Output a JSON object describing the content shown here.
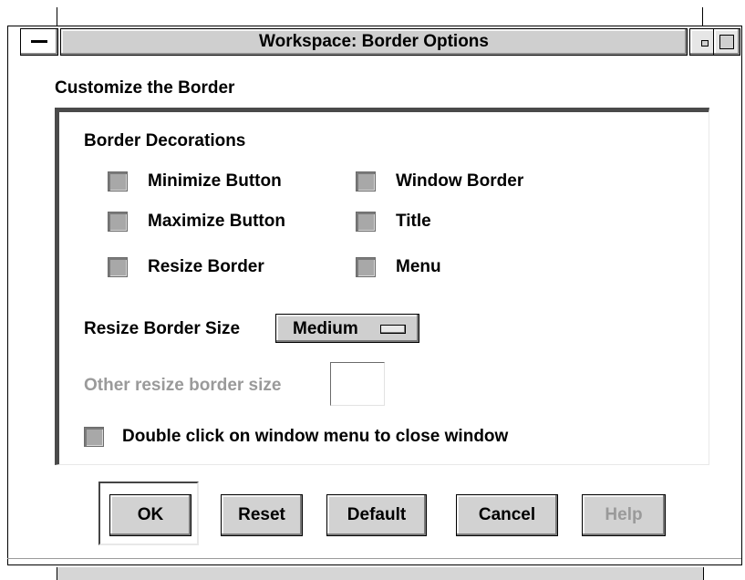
{
  "window": {
    "title": "Workspace: Border Options",
    "menu_icon": "window-menu-icon",
    "minimize_icon": "minimize-icon",
    "maximize_icon": "maximize-icon"
  },
  "heading": "Customize the Border",
  "group": {
    "title": "Border Decorations",
    "checkboxes": [
      {
        "label": "Minimize Button"
      },
      {
        "label": "Maximize Button"
      },
      {
        "label": "Resize Border"
      },
      {
        "label": "Window Border"
      },
      {
        "label": "Title"
      },
      {
        "label": "Menu"
      }
    ],
    "resize_border_size_label": "Resize Border Size",
    "resize_border_size_value": "Medium",
    "other_size_label": "Other resize border size",
    "other_size_value": "",
    "double_click_label": "Double click on window menu to close window"
  },
  "buttons": {
    "ok": "OK",
    "reset": "Reset",
    "default": "Default",
    "cancel": "Cancel",
    "help": "Help"
  },
  "colors": {
    "title_bar": "#cfcfcf",
    "button_face": "#d2d2d2",
    "disabled_text": "#9a9a9a"
  }
}
